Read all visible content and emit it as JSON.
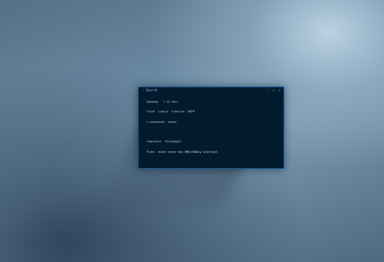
{
  "window": {
    "title": "Search",
    "back_icon": "arrow-left-icon",
    "controls": {
      "minimize": "–",
      "maximize": "□",
      "close": "×"
    }
  },
  "terminal": {
    "lines": [
      "Gateway   7.15 Serv",
      "Fixed  Lumple  Timeline  DOFM",
      "x.xxxxxxxxx  xxxxx",
      "",
      "Campience  Serengapd/",
      "Plays  enxer asser ans BMEresBbxy Insertact"
    ]
  },
  "colors": {
    "window_bg": "#021a2e",
    "window_border": "#1e5f95",
    "text": "#b9d4ea"
  }
}
